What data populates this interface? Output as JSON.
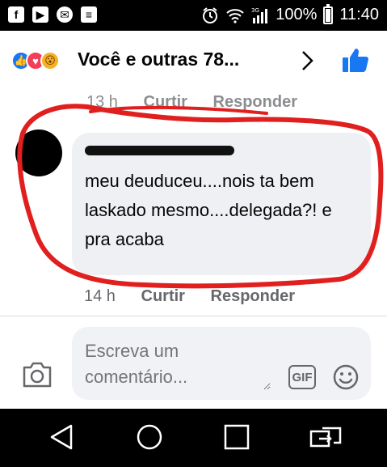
{
  "status_bar": {
    "battery": "100%",
    "time": "11:40",
    "network": "3G",
    "left_icons": [
      "facebook-icon",
      "youtube-icon",
      "messenger-icon",
      "news-icon"
    ]
  },
  "header": {
    "title": "Você e outras 78...",
    "reactions": [
      "like",
      "love",
      "wow"
    ]
  },
  "comments": [
    {
      "time": "13 h",
      "like_label": "Curtir",
      "reply_label": "Responder"
    },
    {
      "author": "",
      "text": "meu deuduceu....nois ta bem laskado mesmo....delegada?! e pra acaba",
      "time": "14 h",
      "like_label": "Curtir",
      "reply_label": "Responder"
    }
  ],
  "composer": {
    "placeholder": "Escreva um comentário...",
    "gif_label": "GIF"
  },
  "colors": {
    "accent": "#1877f2",
    "annotation": "#e0201f"
  }
}
